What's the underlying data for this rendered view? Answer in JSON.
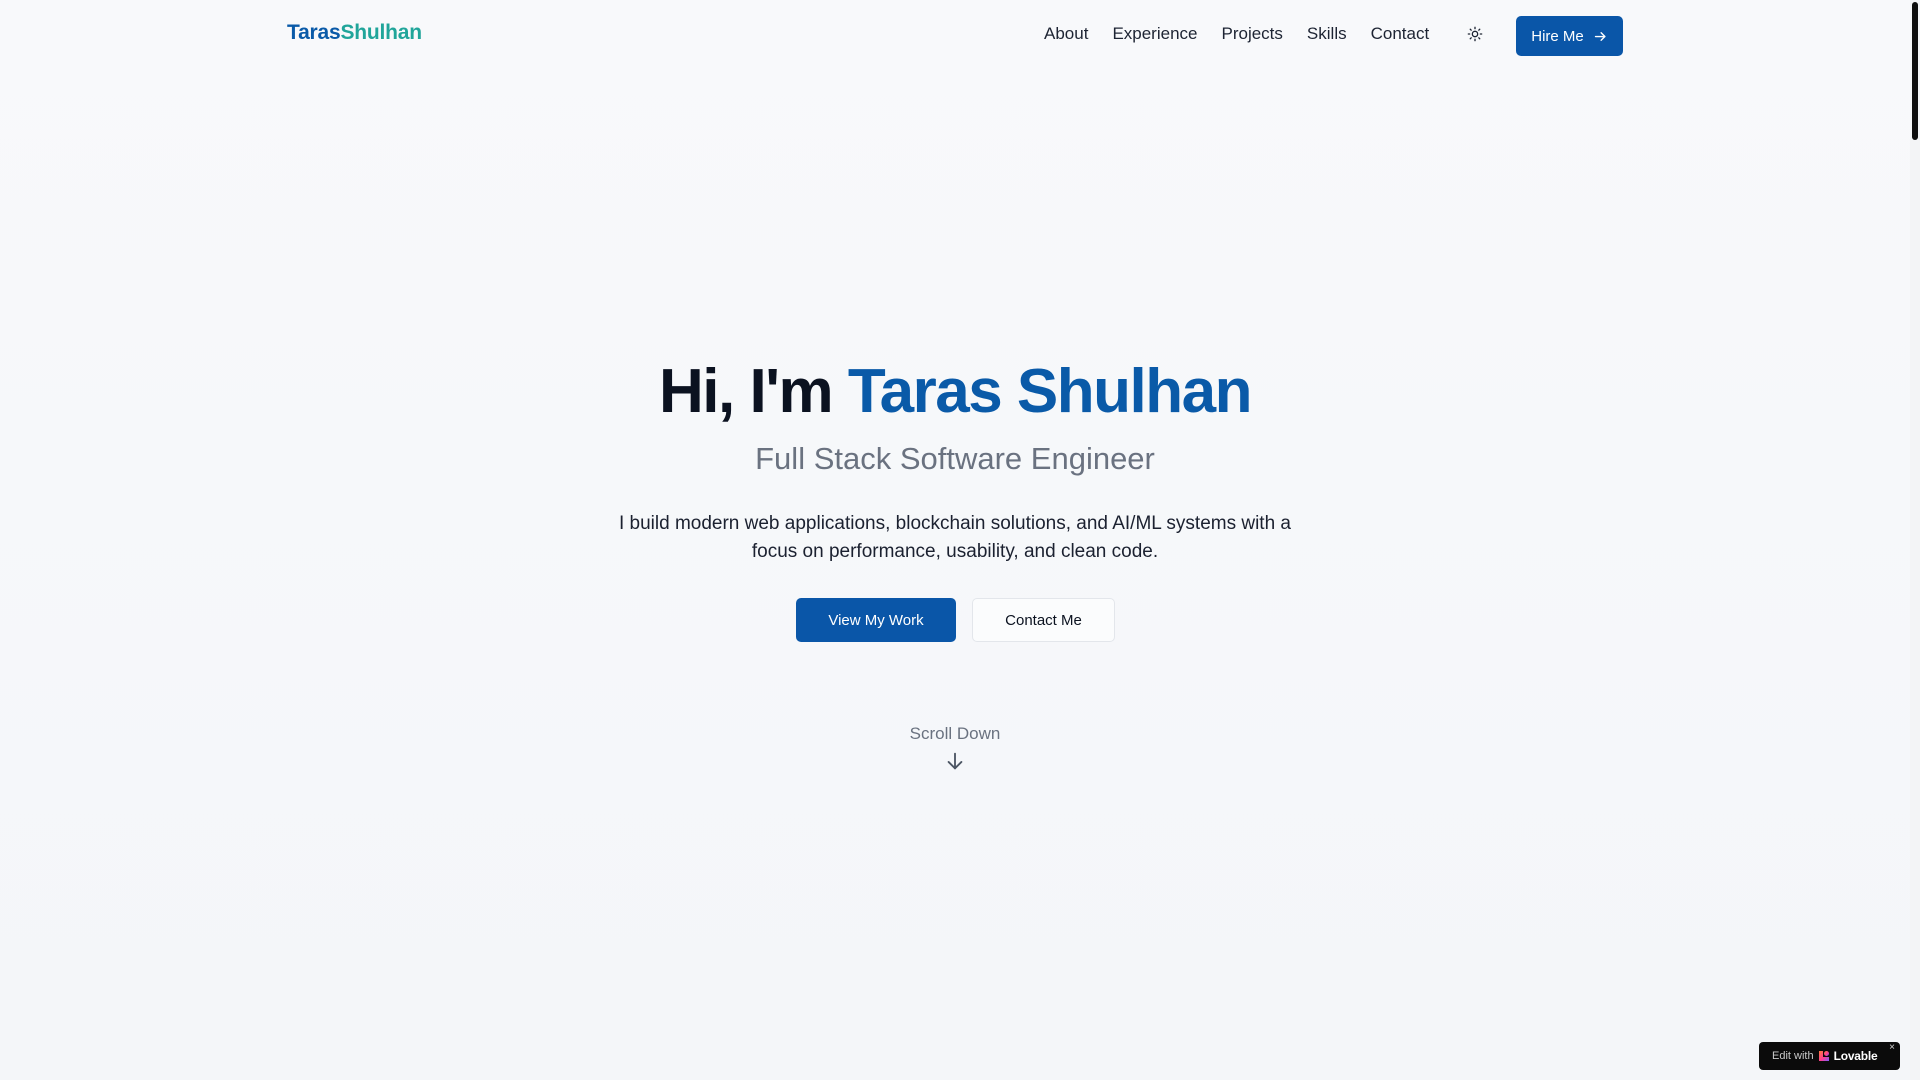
{
  "header": {
    "logo_first": "Taras",
    "logo_last": "Shulhan",
    "nav": [
      "About",
      "Experience",
      "Projects",
      "Skills",
      "Contact"
    ],
    "theme_icon": "sun-icon",
    "hire_label": "Hire Me",
    "hire_icon": "arrow-right-icon"
  },
  "hero": {
    "greeting": "Hi, I'm",
    "name": "Taras Shulhan",
    "subtitle": "Full Stack Software Engineer",
    "description": "I build modern web applications, blockchain solutions, and AI/ML systems with a focus on performance, usability, and clean code.",
    "primary_cta": "View My Work",
    "secondary_cta": "Contact Me",
    "scroll_label": "Scroll Down",
    "scroll_icon": "arrow-down-icon"
  },
  "badge": {
    "prefix": "Edit with",
    "brand": "Lovable",
    "close": "×"
  },
  "colors": {
    "primary": "#0a56a8",
    "accent_teal": "#20a59a",
    "background": "#f8f9fb",
    "muted_text": "#6a7280"
  }
}
